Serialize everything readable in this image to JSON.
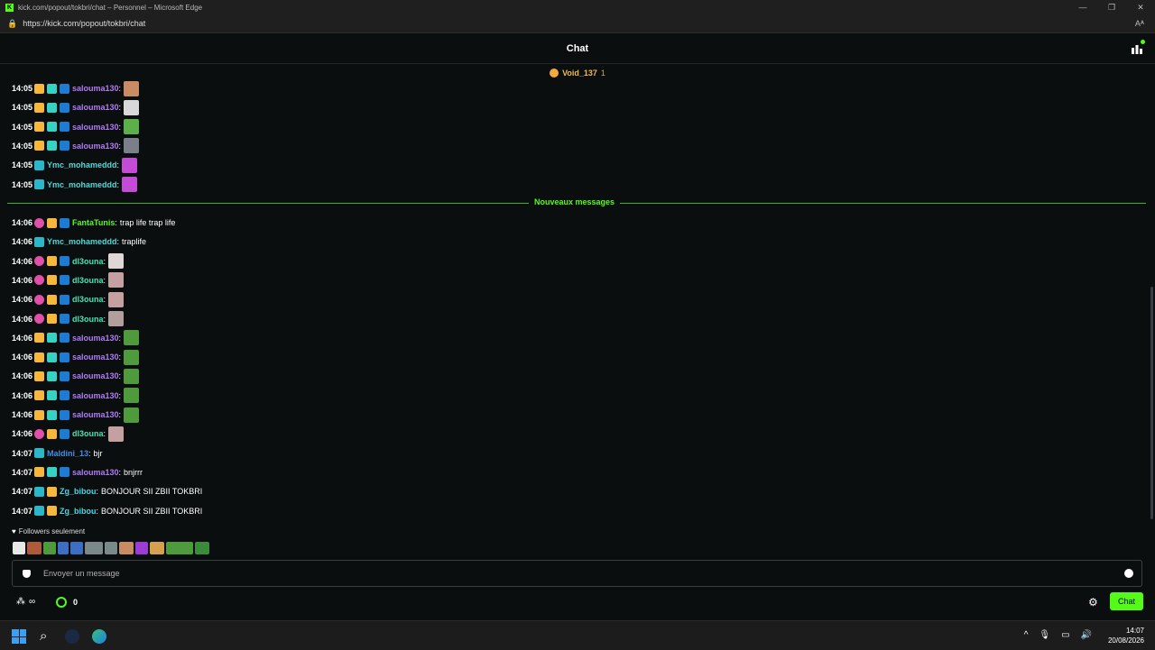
{
  "window": {
    "title": "kick.com/popout/tokbri/chat – Personnel – Microsoft Edge",
    "url": "https://kick.com/popout/tokbri/chat",
    "reader_label": "Aᴬ"
  },
  "header": {
    "title": "Chat"
  },
  "pinned": {
    "name": "Void_137",
    "count": "1"
  },
  "colors": {
    "purple": "#b07cf4",
    "teal": "#4fd8d8",
    "green": "#53fc18",
    "mint": "#43e4b0",
    "blue": "#3f8fe8",
    "cyan": "#41d9e6"
  },
  "messages_before": [
    {
      "time": "14:05",
      "badges": [
        "crown",
        "og",
        "prime"
      ],
      "user": "salouma130",
      "color": "#b07cf4",
      "text": "",
      "emote": "#c98b63"
    },
    {
      "time": "14:05",
      "badges": [
        "crown",
        "og",
        "prime"
      ],
      "user": "salouma130",
      "color": "#b07cf4",
      "text": "",
      "emote": "#d8d8d8"
    },
    {
      "time": "14:05",
      "badges": [
        "crown",
        "og",
        "prime"
      ],
      "user": "salouma130",
      "color": "#b07cf4",
      "text": "",
      "emote": "#5bb04a"
    },
    {
      "time": "14:05",
      "badges": [
        "crown",
        "og",
        "prime"
      ],
      "user": "salouma130",
      "color": "#b07cf4",
      "text": "",
      "emote": "#7a7f8a"
    },
    {
      "time": "14:05",
      "badges": [
        "sub"
      ],
      "user": "Ymc_mohameddd",
      "color": "#4fd8d8",
      "text": "",
      "emote": "#c34bd6"
    },
    {
      "time": "14:05",
      "badges": [
        "sub"
      ],
      "user": "Ymc_mohameddd",
      "color": "#4fd8d8",
      "text": "",
      "emote": "#c34bd6"
    }
  ],
  "divider_label": "Nouveaux messages",
  "messages_after": [
    {
      "time": "14:06",
      "badges": [
        "pink",
        "crown",
        "prime"
      ],
      "user": "FantaTunis",
      "color": "#53fc18",
      "text": "trap life trap life",
      "emote": ""
    },
    {
      "time": "14:06",
      "badges": [
        "sub"
      ],
      "user": "Ymc_mohameddd",
      "color": "#4fd8d8",
      "text": "traplife",
      "emote": ""
    },
    {
      "time": "14:06",
      "badges": [
        "pink",
        "crown",
        "prime"
      ],
      "user": "dl3ouna",
      "color": "#43e4b0",
      "text": "",
      "emote": "#e0d6d6"
    },
    {
      "time": "14:06",
      "badges": [
        "pink",
        "crown",
        "prime"
      ],
      "user": "dl3ouna",
      "color": "#43e4b0",
      "text": "",
      "emote": "#c4a0a0"
    },
    {
      "time": "14:06",
      "badges": [
        "pink",
        "crown",
        "prime"
      ],
      "user": "dl3ouna",
      "color": "#43e4b0",
      "text": "",
      "emote": "#c4a0a0"
    },
    {
      "time": "14:06",
      "badges": [
        "pink",
        "crown",
        "prime"
      ],
      "user": "dl3ouna",
      "color": "#43e4b0",
      "text": "",
      "emote": "#b39e9e"
    },
    {
      "time": "14:06",
      "badges": [
        "crown",
        "og",
        "prime"
      ],
      "user": "salouma130",
      "color": "#b07cf4",
      "text": "",
      "emote": "#4f9a3c"
    },
    {
      "time": "14:06",
      "badges": [
        "crown",
        "og",
        "prime"
      ],
      "user": "salouma130",
      "color": "#b07cf4",
      "text": "",
      "emote": "#4f9a3c"
    },
    {
      "time": "14:06",
      "badges": [
        "crown",
        "og",
        "prime"
      ],
      "user": "salouma130",
      "color": "#b07cf4",
      "text": "",
      "emote": "#4f9a3c"
    },
    {
      "time": "14:06",
      "badges": [
        "crown",
        "og",
        "prime"
      ],
      "user": "salouma130",
      "color": "#b07cf4",
      "text": "",
      "emote": "#4f9a3c"
    },
    {
      "time": "14:06",
      "badges": [
        "crown",
        "og",
        "prime"
      ],
      "user": "salouma130",
      "color": "#b07cf4",
      "text": "",
      "emote": "#4f9a3c"
    },
    {
      "time": "14:06",
      "badges": [
        "pink",
        "crown",
        "prime"
      ],
      "user": "dl3ouna",
      "color": "#43e4b0",
      "text": "",
      "emote": "#c4a0a0"
    },
    {
      "time": "14:07",
      "badges": [
        "sub"
      ],
      "user": "Maldini_13",
      "color": "#3f8fe8",
      "text": "bjr",
      "emote": ""
    },
    {
      "time": "14:07",
      "badges": [
        "crown",
        "og",
        "prime"
      ],
      "user": "salouma130",
      "color": "#b07cf4",
      "text": "bnjrrr",
      "emote": ""
    },
    {
      "time": "14:07",
      "badges": [
        "sub",
        "crown"
      ],
      "user": "Zg_bibou",
      "color": "#41d9e6",
      "text": "BONJOUR SII ZBII TOKBRI",
      "emote": ""
    },
    {
      "time": "14:07",
      "badges": [
        "sub",
        "crown"
      ],
      "user": "Zg_bibou",
      "color": "#41d9e6",
      "text": "BONJOUR SII ZBII TOKBRI",
      "emote": ""
    }
  ],
  "followers_label": "Followers seulement",
  "emote_bar": [
    "#e8e8e8",
    "#b05a3c",
    "#4f9a3c",
    "#3c6fc4",
    "#3c6fc4",
    "#7a8a8a",
    "#7a8a8a",
    "#c98b63",
    "#9b3cd6",
    "#d6a04f",
    "#4f9a3c",
    "#3c8a3c"
  ],
  "input": {
    "placeholder": "Envoyer un message"
  },
  "footer": {
    "infinity": "∞",
    "points": "0",
    "chat_button": "Chat"
  },
  "taskbar": {
    "time": "14:07",
    "date": "20/08/2026"
  }
}
